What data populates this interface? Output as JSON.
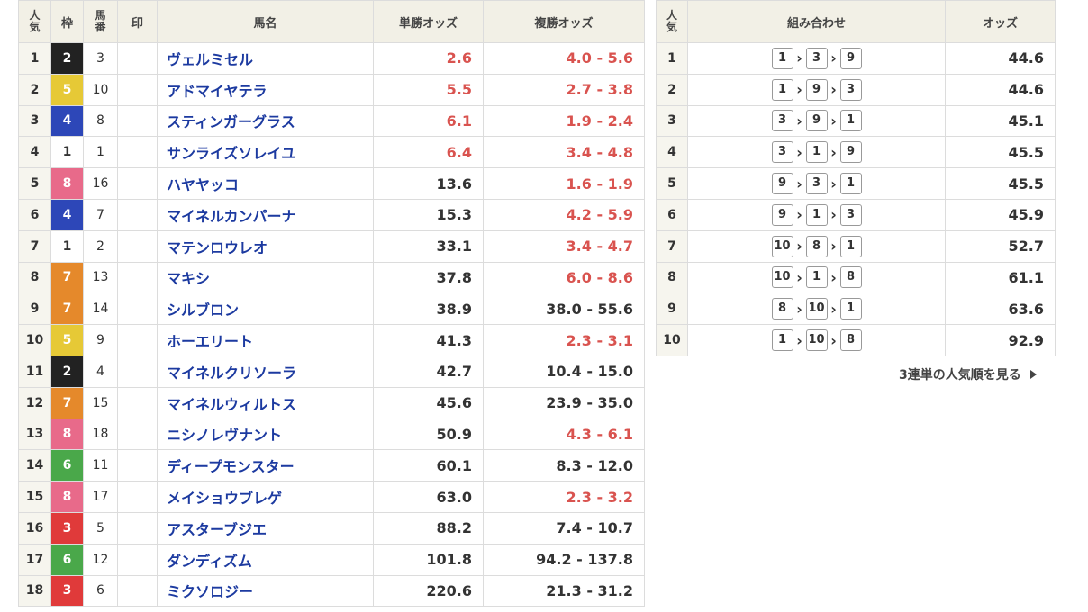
{
  "main_table": {
    "headers": {
      "rank": "人気",
      "waku": "枠",
      "umaban": "馬番",
      "mark": "印",
      "name": "馬名",
      "win": "単勝オッズ",
      "place": "複勝オッズ"
    },
    "rows": [
      {
        "rank": "1",
        "waku": "2",
        "umaban": "3",
        "name": "ヴェルミセル",
        "win": "2.6",
        "place": "4.0 - 5.6",
        "win_hot": true,
        "place_hot": true
      },
      {
        "rank": "2",
        "waku": "5",
        "umaban": "10",
        "name": "アドマイヤテラ",
        "win": "5.5",
        "place": "2.7 - 3.8",
        "win_hot": true,
        "place_hot": true
      },
      {
        "rank": "3",
        "waku": "4",
        "umaban": "8",
        "name": "スティンガーグラス",
        "win": "6.1",
        "place": "1.9 - 2.4",
        "win_hot": true,
        "place_hot": true
      },
      {
        "rank": "4",
        "waku": "1",
        "umaban": "1",
        "name": "サンライズソレイユ",
        "win": "6.4",
        "place": "3.4 - 4.8",
        "win_hot": true,
        "place_hot": true
      },
      {
        "rank": "5",
        "waku": "8",
        "umaban": "16",
        "name": "ハヤヤッコ",
        "win": "13.6",
        "place": "1.6 - 1.9",
        "win_hot": false,
        "place_hot": true
      },
      {
        "rank": "6",
        "waku": "4",
        "umaban": "7",
        "name": "マイネルカンパーナ",
        "win": "15.3",
        "place": "4.2 - 5.9",
        "win_hot": false,
        "place_hot": true
      },
      {
        "rank": "7",
        "waku": "1",
        "umaban": "2",
        "name": "マテンロウレオ",
        "win": "33.1",
        "place": "3.4 - 4.7",
        "win_hot": false,
        "place_hot": true
      },
      {
        "rank": "8",
        "waku": "7",
        "umaban": "13",
        "name": "マキシ",
        "win": "37.8",
        "place": "6.0 - 8.6",
        "win_hot": false,
        "place_hot": true
      },
      {
        "rank": "9",
        "waku": "7",
        "umaban": "14",
        "name": "シルブロン",
        "win": "38.9",
        "place": "38.0 - 55.6",
        "win_hot": false,
        "place_hot": false
      },
      {
        "rank": "10",
        "waku": "5",
        "umaban": "9",
        "name": "ホーエリート",
        "win": "41.3",
        "place": "2.3 - 3.1",
        "win_hot": false,
        "place_hot": true
      },
      {
        "rank": "11",
        "waku": "2",
        "umaban": "4",
        "name": "マイネルクリソーラ",
        "win": "42.7",
        "place": "10.4 - 15.0",
        "win_hot": false,
        "place_hot": false
      },
      {
        "rank": "12",
        "waku": "7",
        "umaban": "15",
        "name": "マイネルウィルトス",
        "win": "45.6",
        "place": "23.9 - 35.0",
        "win_hot": false,
        "place_hot": false
      },
      {
        "rank": "13",
        "waku": "8",
        "umaban": "18",
        "name": "ニシノレヴナント",
        "win": "50.9",
        "place": "4.3 - 6.1",
        "win_hot": false,
        "place_hot": true
      },
      {
        "rank": "14",
        "waku": "6",
        "umaban": "11",
        "name": "ディープモンスター",
        "win": "60.1",
        "place": "8.3 - 12.0",
        "win_hot": false,
        "place_hot": false
      },
      {
        "rank": "15",
        "waku": "8",
        "umaban": "17",
        "name": "メイショウブレゲ",
        "win": "63.0",
        "place": "2.3 - 3.2",
        "win_hot": false,
        "place_hot": true
      },
      {
        "rank": "16",
        "waku": "3",
        "umaban": "5",
        "name": "アスターブジエ",
        "win": "88.2",
        "place": "7.4 - 10.7",
        "win_hot": false,
        "place_hot": false
      },
      {
        "rank": "17",
        "waku": "6",
        "umaban": "12",
        "name": "ダンディズム",
        "win": "101.8",
        "place": "94.2 - 137.8",
        "win_hot": false,
        "place_hot": false
      },
      {
        "rank": "18",
        "waku": "3",
        "umaban": "6",
        "name": "ミクソロジー",
        "win": "220.6",
        "place": "21.3 - 31.2",
        "win_hot": false,
        "place_hot": false
      }
    ]
  },
  "waku_colors": {
    "1": {
      "bg": "#ffffff",
      "fg": "#333333"
    },
    "2": {
      "bg": "#222222",
      "fg": "#ffffff"
    },
    "3": {
      "bg": "#e03a3a",
      "fg": "#ffffff"
    },
    "4": {
      "bg": "#2d47b8",
      "fg": "#ffffff"
    },
    "5": {
      "bg": "#e6c936",
      "fg": "#ffffff"
    },
    "6": {
      "bg": "#4aa84a",
      "fg": "#ffffff"
    },
    "7": {
      "bg": "#e5892b",
      "fg": "#ffffff"
    },
    "8": {
      "bg": "#e86a8a",
      "fg": "#ffffff"
    }
  },
  "colors": {
    "hot": "#d9534f",
    "name": "#1c3aa0",
    "header_bg": "#f2f0e6"
  },
  "combo_table": {
    "headers": {
      "rank": "人気",
      "combo": "組み合わせ",
      "odds": "オッズ"
    },
    "rows": [
      {
        "rank": "1",
        "combo": [
          "1",
          "3",
          "9"
        ],
        "odds": "44.6"
      },
      {
        "rank": "2",
        "combo": [
          "1",
          "9",
          "3"
        ],
        "odds": "44.6"
      },
      {
        "rank": "3",
        "combo": [
          "3",
          "9",
          "1"
        ],
        "odds": "45.1"
      },
      {
        "rank": "4",
        "combo": [
          "3",
          "1",
          "9"
        ],
        "odds": "45.5"
      },
      {
        "rank": "5",
        "combo": [
          "9",
          "3",
          "1"
        ],
        "odds": "45.5"
      },
      {
        "rank": "6",
        "combo": [
          "9",
          "1",
          "3"
        ],
        "odds": "45.9"
      },
      {
        "rank": "7",
        "combo": [
          "10",
          "8",
          "1"
        ],
        "odds": "52.7"
      },
      {
        "rank": "8",
        "combo": [
          "10",
          "1",
          "8"
        ],
        "odds": "61.1"
      },
      {
        "rank": "9",
        "combo": [
          "8",
          "10",
          "1"
        ],
        "odds": "63.6"
      },
      {
        "rank": "10",
        "combo": [
          "1",
          "10",
          "8"
        ],
        "odds": "92.9"
      }
    ],
    "arrow": "›"
  },
  "more_link": "3連単の人気順を見る"
}
